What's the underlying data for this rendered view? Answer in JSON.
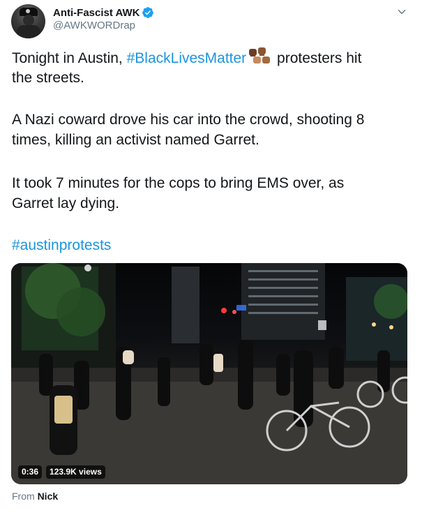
{
  "author": {
    "display_name": "Anti-Fascist AWK",
    "handle": "@AWKWORDrap",
    "verified": true
  },
  "tweet": {
    "line1_a": "Tonight in Austin, ",
    "hashtag1": "#BlackLivesMatter",
    "line1_b": " protesters hit",
    "line2": "the streets.",
    "line3": "A Nazi coward drove his car into the crowd, shooting 8",
    "line4": "times, killing an activist named Garret.",
    "line5": "It took 7 minutes for the cops to bring EMS over, as",
    "line6": "Garret lay dying.",
    "hashtag2": "#austinprotests"
  },
  "video": {
    "duration": "0:36",
    "views": "123.9K views"
  },
  "source": {
    "prefix": "From",
    "name": "Nick"
  },
  "icons": {
    "verified": "verified-badge-icon",
    "menu": "chevron-down-icon",
    "emoji": "raised-fists-emoji"
  },
  "colors": {
    "link": "#1b95e0",
    "verified": "#1da1f2",
    "secondary_text": "#657786"
  }
}
